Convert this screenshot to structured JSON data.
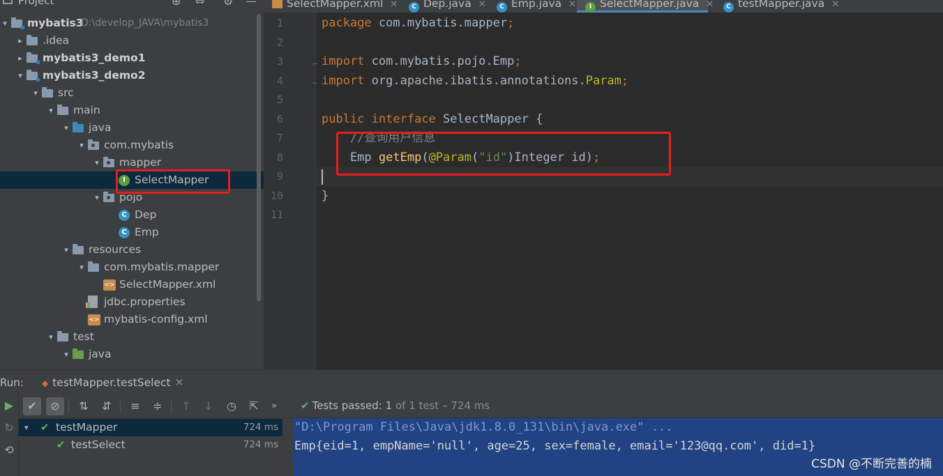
{
  "project_panel": {
    "title": "Project",
    "tree": [
      {
        "label": "mybatis3",
        "path": "D:\\develop_JAVA\\mybatis3",
        "bold": true,
        "arrow": "▾",
        "icon": "module-folder-icon"
      },
      {
        "label": ".idea",
        "arrow": "▸",
        "icon": "folder-icon"
      },
      {
        "label": "mybatis3_demo1",
        "bold": true,
        "arrow": "▸",
        "icon": "module-folder-icon"
      },
      {
        "label": "mybatis3_demo2",
        "bold": true,
        "arrow": "▾",
        "icon": "module-folder-icon"
      },
      {
        "label": "src",
        "arrow": "▾",
        "icon": "folder-icon"
      },
      {
        "label": "main",
        "arrow": "▾",
        "icon": "folder-icon"
      },
      {
        "label": "java",
        "arrow": "▾",
        "icon": "source-folder-icon"
      },
      {
        "label": "com.mybatis",
        "arrow": "▾",
        "icon": "package-icon"
      },
      {
        "label": "mapper",
        "arrow": "▾",
        "icon": "package-icon"
      },
      {
        "label": "SelectMapper",
        "icon": "interface-icon"
      },
      {
        "label": "pojo",
        "arrow": "▾",
        "icon": "package-icon"
      },
      {
        "label": "Dep",
        "icon": "class-icon"
      },
      {
        "label": "Emp",
        "icon": "class-icon"
      },
      {
        "label": "resources",
        "arrow": "▾",
        "icon": "resources-folder-icon"
      },
      {
        "label": "com.mybatis.mapper",
        "arrow": "▾",
        "icon": "folder-icon"
      },
      {
        "label": "SelectMapper.xml",
        "icon": "xml-file-icon"
      },
      {
        "label": "jdbc.properties",
        "icon": "properties-file-icon"
      },
      {
        "label": "mybatis-config.xml",
        "icon": "xml-file-icon"
      },
      {
        "label": "test",
        "arrow": "▾",
        "icon": "folder-icon"
      },
      {
        "label": "java",
        "arrow": "▾",
        "icon": "test-source-folder-icon"
      }
    ]
  },
  "tabs": [
    {
      "label": "SelectMapper.xml",
      "icon": "xml-file-icon"
    },
    {
      "label": "Dep.java",
      "icon": "class-icon"
    },
    {
      "label": "Emp.java",
      "icon": "class-icon"
    },
    {
      "label": "SelectMapper.java",
      "icon": "interface-icon",
      "active": true
    },
    {
      "label": "testMapper.java",
      "icon": "class-icon"
    }
  ],
  "editor": {
    "line_numbers": [
      "1",
      "2",
      "3",
      "4",
      "5",
      "6",
      "7",
      "8",
      "9",
      "10",
      "11"
    ],
    "lines": [
      [
        {
          "t": "package",
          "c": "kw"
        },
        {
          "t": " com.mybatis.mapper"
        },
        {
          "t": ";",
          "c": "kw"
        }
      ],
      [],
      [
        {
          "t": "import",
          "c": "kw"
        },
        {
          "t": " com.mybatis.pojo.Emp"
        },
        {
          "t": ";",
          "c": "kw"
        }
      ],
      [
        {
          "t": "import",
          "c": "kw"
        },
        {
          "t": " org.apache.ibatis.annotations."
        },
        {
          "t": "Param",
          "c": "ann"
        },
        {
          "t": ";",
          "c": "kw"
        }
      ],
      [],
      [
        {
          "t": "public",
          "c": "kw"
        },
        {
          "t": " "
        },
        {
          "t": "interface",
          "c": "kw"
        },
        {
          "t": " SelectMapper {"
        }
      ],
      [
        {
          "t": "    "
        },
        {
          "t": "//查询用户信息",
          "c": "cmt"
        }
      ],
      [
        {
          "t": "    Emp "
        },
        {
          "t": "getEmp",
          "c": "fn"
        },
        {
          "t": "("
        },
        {
          "t": "@Param",
          "c": "ann"
        },
        {
          "t": "("
        },
        {
          "t": "\"id\"",
          "c": "str"
        },
        {
          "t": ")Integer id)"
        },
        {
          "t": ";",
          "c": "kw"
        }
      ],
      [],
      [
        {
          "t": "}"
        }
      ],
      []
    ]
  },
  "run_panel": {
    "label": "Run:",
    "tab_label": "testMapper.testSelect",
    "tests_passed_label": "Tests passed:",
    "tests_count": "1",
    "tests_total": "of 1 test – 724 ms",
    "tree": [
      {
        "label": "testMapper",
        "time": "724 ms"
      },
      {
        "label": "testSelect",
        "time": "724 ms"
      }
    ],
    "console": [
      "\"D:\\Program Files\\Java\\jdk1.8.0_131\\bin\\java.exe\" ...",
      "Emp{eid=1, empName='null', age=25, sex=female, email='123@qq.com', did=1}"
    ]
  },
  "watermark": "CSDN @不断完善的楠"
}
